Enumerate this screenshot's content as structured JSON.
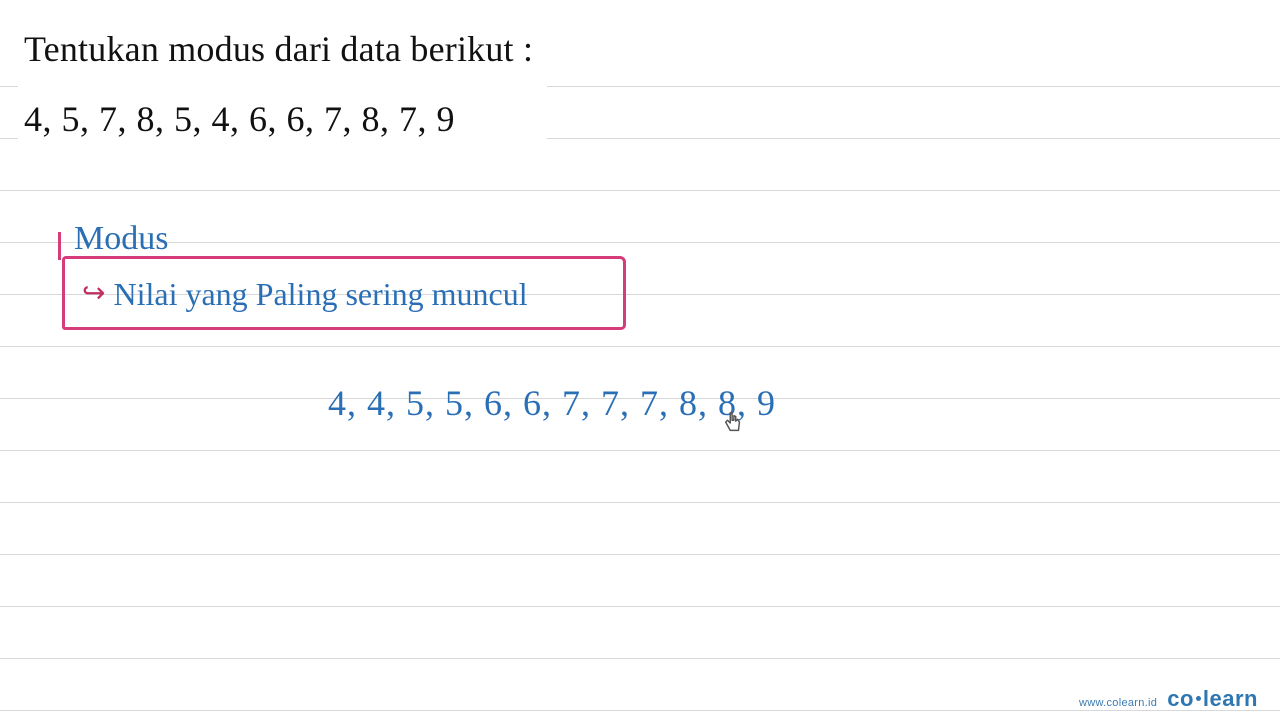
{
  "question": {
    "title": "Tentukan modus dari data berikut :",
    "data_series": "4, 5, 7, 8, 5, 4, 6, 6, 7, 8, 7, 9"
  },
  "work": {
    "concept_label": "Modus",
    "definition": "Nilai yang Paling sering muncul",
    "sorted_series": "4, 4, 5, 5, 6, 6, 7, 7, 7, 8, 8, 9"
  },
  "footer": {
    "url": "www.colearn.id",
    "brand_left": "co",
    "brand_right": "learn"
  },
  "colors": {
    "ink": "#2a6fb5",
    "box": "#d63b7a",
    "text": "#111111",
    "brand": "#2f77b1"
  }
}
